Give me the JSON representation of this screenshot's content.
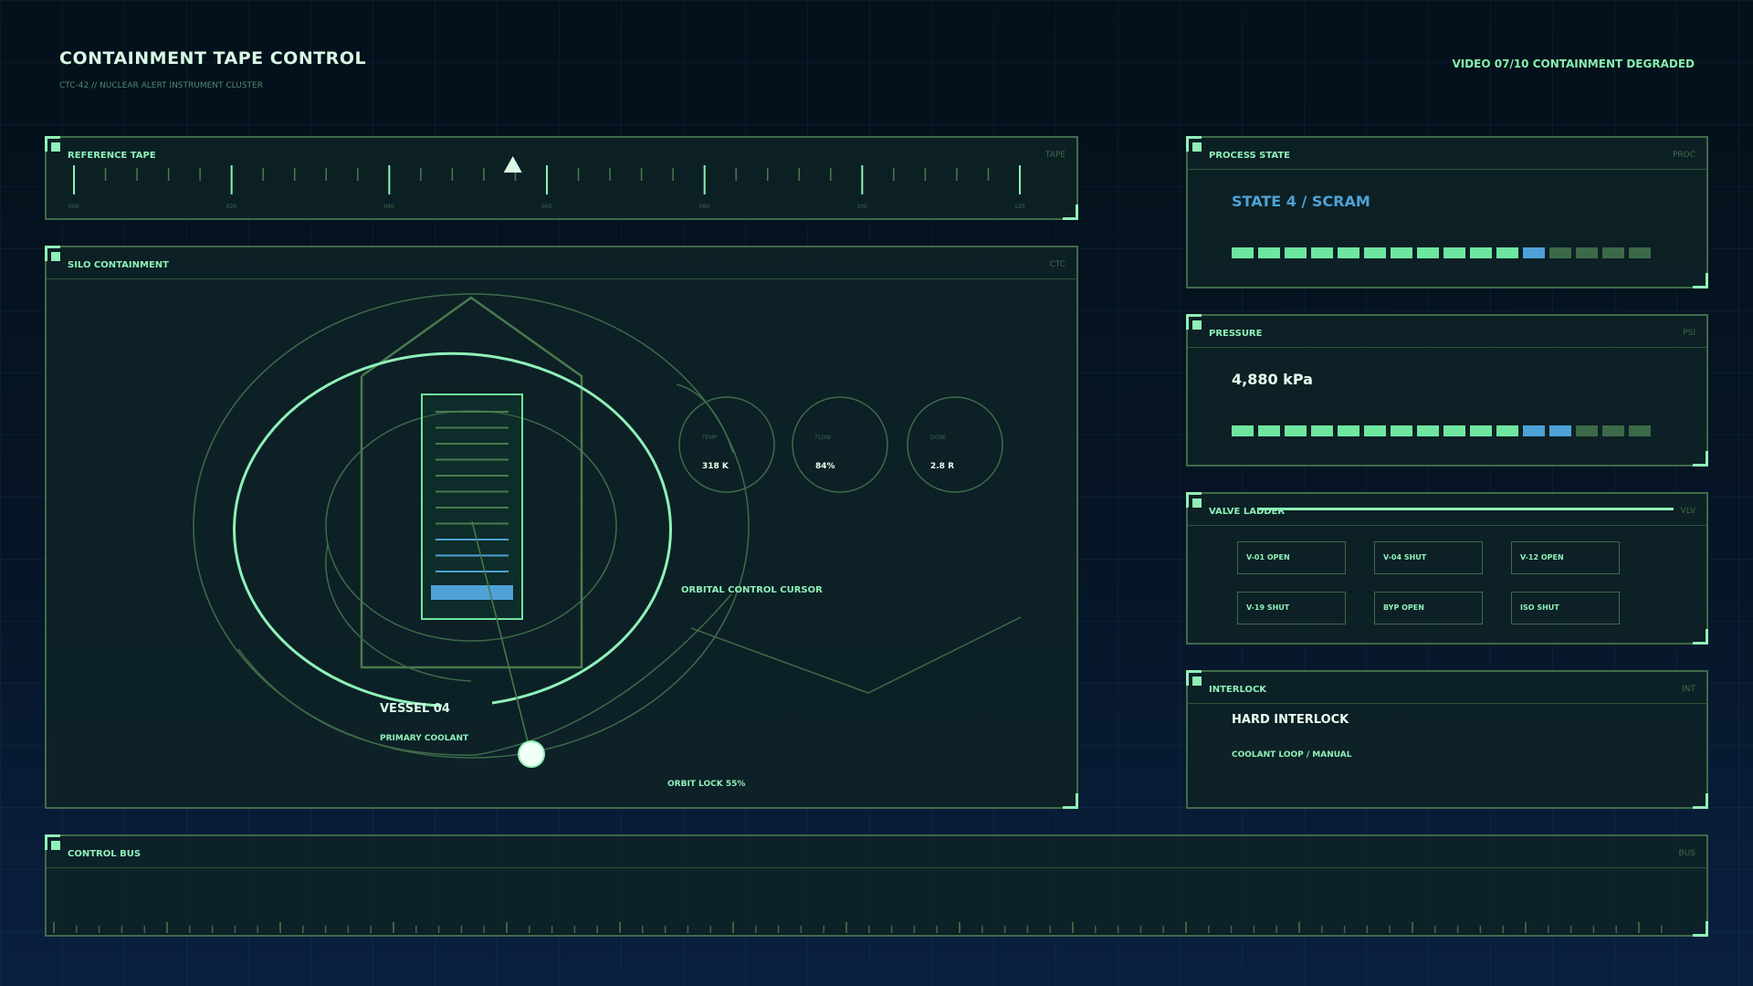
{
  "header": {
    "title": "CONTAINMENT TAPE CONTROL",
    "subtitle": "CTC-42 // NUCLEAR ALERT INSTRUMENT CLUSTER",
    "status": "VIDEO 07/10  CONTAINMENT DEGRADED"
  },
  "reference_tape": {
    "title": "REFERENCE TAPE",
    "tag": "TAPE",
    "labels": [
      "000",
      "020",
      "040",
      "060",
      "080",
      "100",
      "120"
    ],
    "marker_position": 0.464
  },
  "silo": {
    "title": "SILO CONTAINMENT",
    "tag": "CTC",
    "vessel_name": "VESSEL 04",
    "vessel_sub": "PRIMARY COOLANT",
    "cursor_label": "ORBITAL CONTROL CURSOR",
    "orbit_lock": "ORBIT LOCK 55%",
    "gauges": [
      {
        "label": "TEMP",
        "value": "318 K"
      },
      {
        "label": "FLOW",
        "value": "84%"
      },
      {
        "label": "DOSE",
        "value": "2.8 R"
      }
    ]
  },
  "process_state": {
    "title": "PROCESS STATE",
    "tag": "PROC",
    "value": "STATE 4 / SCRAM",
    "segments": [
      "g",
      "g",
      "g",
      "g",
      "g",
      "g",
      "g",
      "g",
      "g",
      "g",
      "g",
      "b",
      "d",
      "d",
      "d",
      "d"
    ]
  },
  "pressure": {
    "title": "PRESSURE",
    "tag": "PSI",
    "value": "4,880 kPa",
    "segments": [
      "g",
      "g",
      "g",
      "g",
      "g",
      "g",
      "g",
      "g",
      "g",
      "g",
      "g",
      "b",
      "b",
      "d",
      "d",
      "d"
    ]
  },
  "valve_ladder": {
    "title": "VALVE LADDER",
    "tag": "VLV",
    "valves": [
      "V-01  OPEN",
      "V-04  SHUT",
      "V-12  OPEN",
      "V-19  SHUT",
      "BYP  OPEN",
      "ISO  SHUT"
    ]
  },
  "interlock": {
    "title": "INTERLOCK",
    "tag": "INT",
    "value": "HARD INTERLOCK",
    "sub": "COOLANT LOOP / MANUAL"
  },
  "control_bus": {
    "title": "CONTROL BUS",
    "tag": "BUS"
  },
  "colors": {
    "accent": "#8ff0b8",
    "blue": "#4ea2d8",
    "dim": "#3c6a48",
    "border": "#3f6b4a"
  }
}
